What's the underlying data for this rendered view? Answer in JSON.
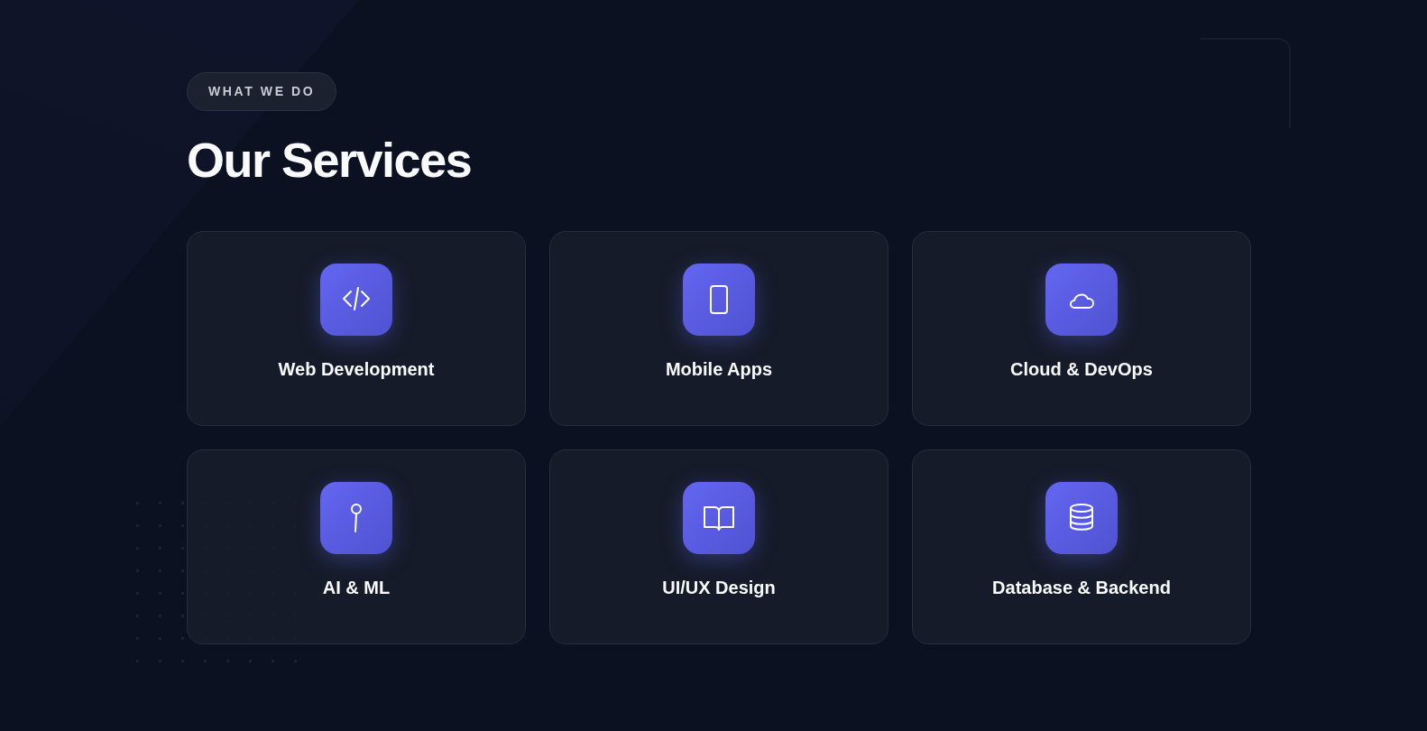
{
  "section": {
    "eyebrow": "WHAT WE DO",
    "title": "Our Services"
  },
  "services": [
    {
      "label": "Web Development"
    },
    {
      "label": "Mobile Apps"
    },
    {
      "label": "Cloud & DevOps"
    },
    {
      "label": "AI & ML"
    },
    {
      "label": "UI/UX Design"
    },
    {
      "label": "Database & Backend"
    }
  ]
}
